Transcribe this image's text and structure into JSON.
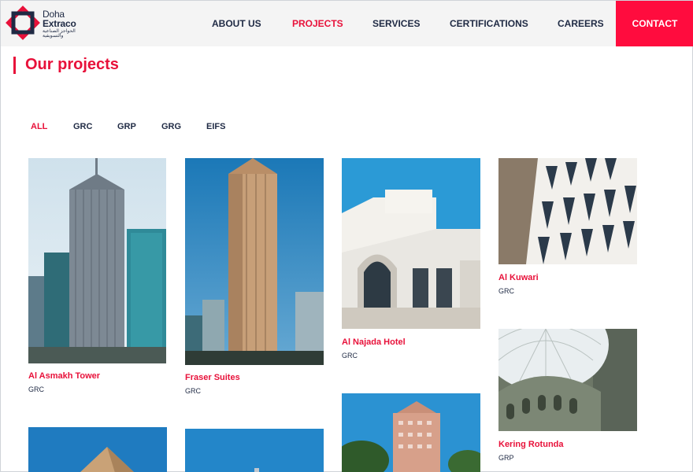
{
  "header": {
    "logo": {
      "line1": "Doha",
      "line2": "Extraco",
      "arabic": "الحواجز الصناعية والتسويقية"
    },
    "nav": [
      {
        "label": "ABOUT US"
      },
      {
        "label": "PROJECTS"
      },
      {
        "label": "SERVICES"
      },
      {
        "label": "CERTIFICATIONS"
      },
      {
        "label": "CAREERS"
      }
    ],
    "contact_label": "CONTACT",
    "active_nav": "PROJECTS",
    "colors": {
      "accent": "#e8113a",
      "contact_bg": "#ff0c3e",
      "header_bg": "#f4f4f4",
      "text": "#1f2a44"
    }
  },
  "main": {
    "title": "Our projects",
    "filters": [
      {
        "label": "ALL",
        "active": true
      },
      {
        "label": "GRC",
        "active": false
      },
      {
        "label": "GRP",
        "active": false
      },
      {
        "label": "GRG",
        "active": false
      },
      {
        "label": "EIFS",
        "active": false
      }
    ],
    "projects": [
      {
        "name": "Al Asmakh Tower",
        "category": "GRC",
        "image": "glass-skyscrapers-photo"
      },
      {
        "name": "Fraser Suites",
        "category": "GRC",
        "image": "beige-tower-photo"
      },
      {
        "name": "Al Najada Hotel",
        "category": "GRC",
        "image": "white-arched-hotel-photo"
      },
      {
        "name": "Al Kuwari",
        "category": "GRC",
        "image": "lattice-facade-photo"
      },
      {
        "name": "Kering Rotunda",
        "category": "GRP",
        "image": "dome-interior-photo"
      },
      {
        "name": "",
        "category": "",
        "image": "pyramid-under-blue-sky-photo"
      },
      {
        "name": "",
        "category": "",
        "image": "blue-sky-photo"
      },
      {
        "name": "",
        "category": "",
        "image": "pink-tower-with-trees-photo"
      }
    ]
  }
}
